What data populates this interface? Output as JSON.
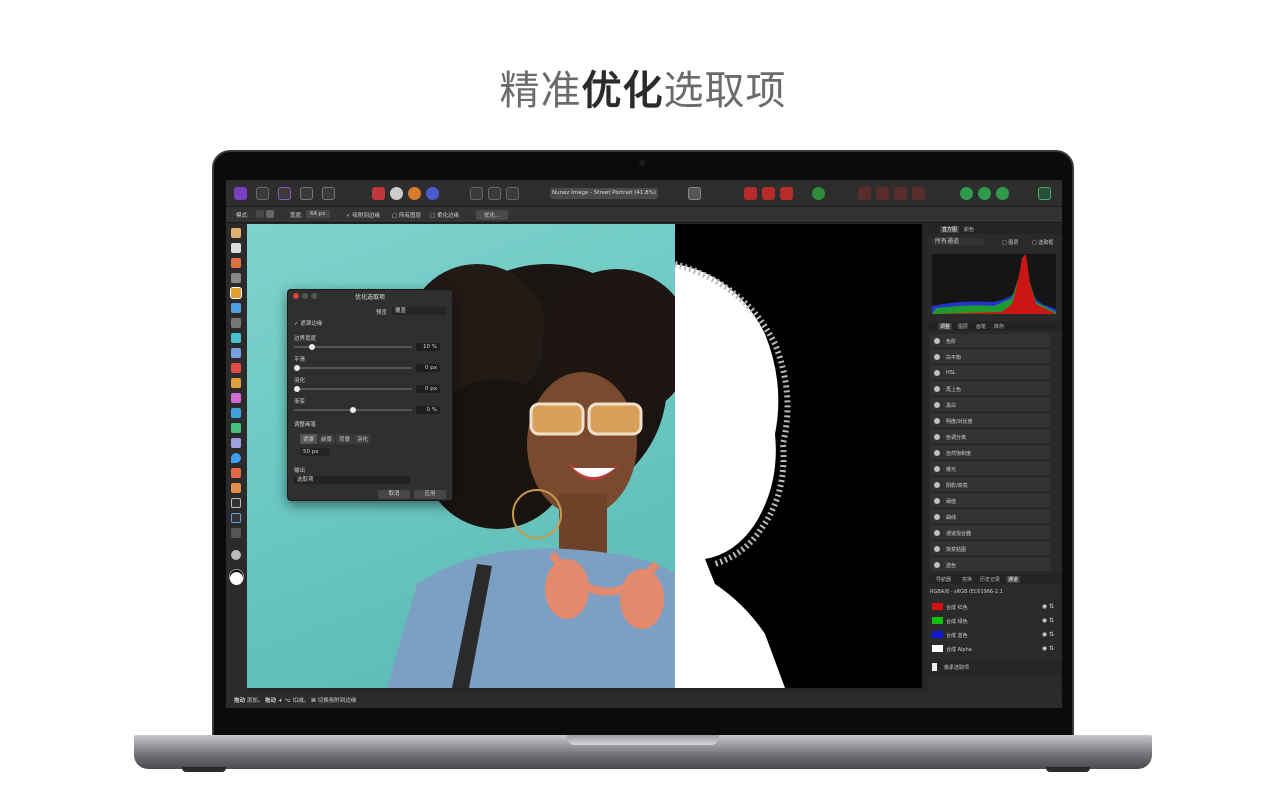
{
  "headline": {
    "part1": "精准",
    "part2": "优化",
    "part3": "选取项"
  },
  "app": {
    "document_title": "Nunez Image - Street Portrait (41.8%)",
    "context_bar": {
      "mode_label": "模式:",
      "width_label": "宽度:",
      "width_value": "64 px",
      "snap_label": "吸附到边缘",
      "all_layers_label": "所有图层",
      "soften_label": "柔化边缘",
      "refine_button": "优化..."
    },
    "status_bar": {
      "drag_label": "拖动",
      "add_text": "添加。",
      "drag2_label": "拖动 + ⌥",
      "remove_text": "扣减。",
      "cmd_label": "⌘",
      "toggle_text": "切换吸附到边缘"
    }
  },
  "refine_dialog": {
    "title": "优化选取项",
    "preview_label": "预览",
    "preview_value": "覆盖",
    "matte_edges": "遮罩边缘",
    "border_width_label": "边界宽度",
    "border_width_value": "10 %",
    "border_width_pct": 0.13,
    "smooth_label": "平滑",
    "smooth_value": "0 px",
    "smooth_pct": 0.0,
    "feather_label": "羽化",
    "feather_value": "0 px",
    "feather_pct": 0.0,
    "ramp_label": "渐变",
    "ramp_value": "0 %",
    "ramp_pct": 0.5,
    "brush_label": "调整画笔",
    "brush_modes": [
      "遮罩",
      "前景",
      "背景",
      "羽化"
    ],
    "brush_size": "50 px",
    "output_label": "输出",
    "output_value": "选取项",
    "cancel": "取消",
    "apply": "应用"
  },
  "right_panel": {
    "histogram_tabs": [
      "直方图",
      "颜色"
    ],
    "channel_select": "所有通道",
    "check_layer": "图层",
    "check_selection": "选取框",
    "adjust_tabs": [
      "调整",
      "图层",
      "画笔",
      "库存"
    ],
    "adjustments": [
      "色阶",
      "白平衡",
      "HSL",
      "再上色",
      "黑白",
      "明度/对比度",
      "色调分离",
      "自然饱和度",
      "曝光",
      "阴影/高亮",
      "阈值",
      "曲线",
      "通道混合器",
      "渐变贴图",
      "选色"
    ],
    "bottom_tabs": [
      "导航器",
      "变换",
      "历史记录",
      "通道"
    ],
    "color_profile": "RGBA/8 - sRGB IEC61966-2.1",
    "channels": [
      {
        "label": "合成 红色",
        "swatch": "#d41010"
      },
      {
        "label": "合成 绿色",
        "swatch": "#10c010"
      },
      {
        "label": "合成 蓝色",
        "swatch": "#1018d4"
      },
      {
        "label": "合成 Alpha",
        "swatch": "#ffffff"
      }
    ],
    "pixel_selection": "像素选取项"
  }
}
